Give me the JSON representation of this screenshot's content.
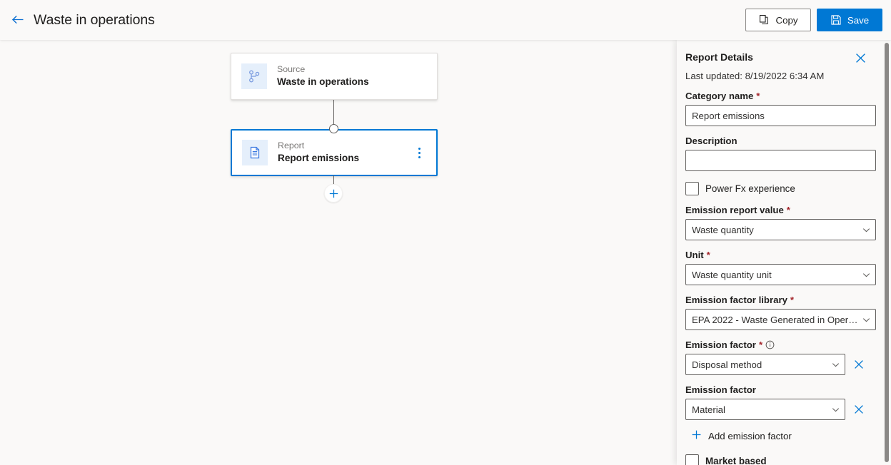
{
  "header": {
    "back_icon": "back-arrow-icon",
    "title": "Waste in operations",
    "copy_label": "Copy",
    "copy_icon": "copy-icon",
    "save_label": "Save",
    "save_icon": "save-disk-icon",
    "accent_color": "#0078d4"
  },
  "canvas": {
    "nodes": [
      {
        "kind": "Source",
        "name": "Waste in operations",
        "icon": "branch-fork-icon",
        "selected": false,
        "has_menu": false
      },
      {
        "kind": "Report",
        "name": "Report emissions",
        "icon": "document-icon",
        "selected": true,
        "has_menu": true,
        "menu_icon": "more-vertical-icon"
      }
    ],
    "add_node_icon": "plus-icon"
  },
  "panel": {
    "title": "Report Details",
    "close_icon": "close-icon",
    "last_updated": "Last updated: 8/19/2022 6:34 AM",
    "fields": {
      "category_name": {
        "label": "Category name",
        "required": "*",
        "value": "Report emissions"
      },
      "description": {
        "label": "Description",
        "value": ""
      },
      "power_fx": {
        "label": "Power Fx experience",
        "checked": false
      },
      "emission_report_value": {
        "label": "Emission report value",
        "required": "*",
        "value": "Waste quantity"
      },
      "unit": {
        "label": "Unit",
        "required": "*",
        "value": "Waste quantity unit"
      },
      "emission_factor_library": {
        "label": "Emission factor library",
        "required": "*",
        "value": "EPA 2022 - Waste Generated in Opera..."
      },
      "emission_factor_1": {
        "label": "Emission factor",
        "required": "*",
        "info_icon": "info-circle-icon",
        "value": "Disposal method",
        "clear_icon": "clear-icon"
      },
      "emission_factor_2": {
        "label": "Emission factor",
        "value": "Material",
        "clear_icon": "clear-icon"
      },
      "add_emission_factor": {
        "label": "Add emission factor",
        "icon": "plus-icon"
      },
      "market_based": {
        "label": "Market based",
        "checked": false
      }
    },
    "scrollbar": "vertical-scrollbar"
  }
}
